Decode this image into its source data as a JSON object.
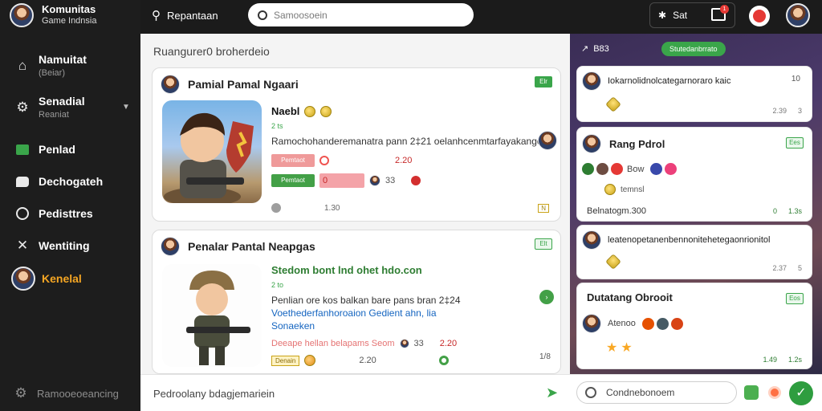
{
  "brand": {
    "title": "Komunitas",
    "subtitle": "Game Indnsia"
  },
  "sidebar": {
    "items": [
      {
        "label": "Namuitat",
        "sub": "(Beiar)"
      },
      {
        "label": "Senadial",
        "sub": "Reaniat"
      },
      {
        "label": "Penlad",
        "sub": ""
      },
      {
        "label": "Dechogateh",
        "sub": ""
      },
      {
        "label": "Pedisttres",
        "sub": ""
      },
      {
        "label": "Wentiting",
        "sub": ""
      },
      {
        "label": "Kenelal",
        "sub": ""
      }
    ],
    "footer": "Ramooeoeancing"
  },
  "topbar": {
    "title": "Repantaan",
    "search_placeholder": "Samoosoein",
    "set_label": "Sat",
    "inbox_badge": "1"
  },
  "feed": {
    "heading": "Ruangurer0 broherdeio",
    "posts": [
      {
        "title": "Pamial Pamal Ngaari",
        "tag": "Elr",
        "item_name": "Naebl",
        "meta": "2 ts",
        "desc": "Ramochohanderemanatra pann 2‡21 oelanhcenmtarfayakango",
        "pink_btn": "Pemtaot",
        "pink_count": "2.20",
        "green_btn": "Pemtaot",
        "bar_value": "0",
        "stat": "33",
        "foot_count": "1.30",
        "foot_tag": "N"
      },
      {
        "title": "Penalar Pantal Neapgas",
        "tag": "Elt",
        "item_name": "Stedom bont lnd ohet hdo.con",
        "meta": "2 to",
        "desc_line1": "Penlian ore kos balkan bare pans bran 2‡24",
        "desc_line2": "Voethederfanhoroaion Gedient ahn, lia",
        "desc_line3": "Sonaeken",
        "pink_text": "Deeape hellan belapams Seom",
        "stat": "33",
        "pink_count": "2.20",
        "gold_btn": "Denain",
        "mid_count": "2.20",
        "foot_count": "1/8"
      }
    ]
  },
  "right": {
    "header": "B83",
    "pill": "Stutedanbrrato",
    "cards": [
      {
        "text": "Iokarnolidnolcategarnoraro kaic",
        "badge": "10",
        "likes": "2.39",
        "shares": "3"
      },
      {
        "title": "Rang Pdrol",
        "tag": "Ees",
        "row_label": "Bow",
        "sub": "temnsl",
        "footer": "Belnatogm.300",
        "likes": "0",
        "views": "1.3s"
      },
      {
        "text": "leatenopetanenbennonitehetegaonrionitol",
        "likes": "2.37",
        "shares": "5"
      },
      {
        "title": "Dutatang Obrooit",
        "tag": "Eos",
        "row_label": "Atenoo",
        "likes": "1.49",
        "views": "1.2s"
      }
    ]
  },
  "composer": {
    "text": "Pedroolany bdagjemariein",
    "comment_placeholder": "Condnebonoem"
  }
}
